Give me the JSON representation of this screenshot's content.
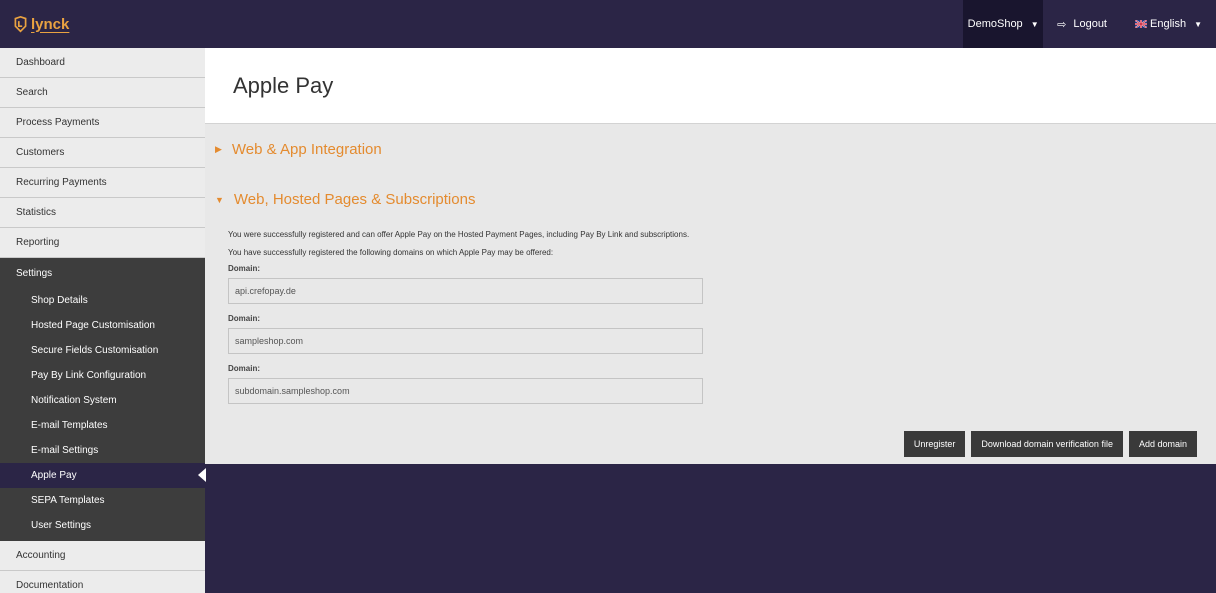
{
  "header": {
    "logo_text": "lynck",
    "shop_selector": "DemoShop",
    "logout_label": "Logout",
    "language_label": "English"
  },
  "sidebar": {
    "items": [
      {
        "label": "Dashboard"
      },
      {
        "label": "Search"
      },
      {
        "label": "Process Payments"
      },
      {
        "label": "Customers"
      },
      {
        "label": "Recurring Payments"
      },
      {
        "label": "Statistics"
      },
      {
        "label": "Reporting"
      },
      {
        "label": "Settings"
      }
    ],
    "settings_sub": [
      {
        "label": "Shop Details"
      },
      {
        "label": "Hosted Page Customisation"
      },
      {
        "label": "Secure Fields Customisation"
      },
      {
        "label": "Pay By Link Configuration"
      },
      {
        "label": "Notification System"
      },
      {
        "label": "E-mail Templates"
      },
      {
        "label": "E-mail Settings"
      },
      {
        "label": "Apple Pay"
      },
      {
        "label": "SEPA Templates"
      },
      {
        "label": "User Settings"
      }
    ],
    "bottom_items": [
      {
        "label": "Accounting"
      },
      {
        "label": "Documentation"
      }
    ]
  },
  "main": {
    "page_title": "Apple Pay",
    "section_web_app": "Web & App Integration",
    "section_hosted": "Web, Hosted Pages & Subscriptions",
    "msg_registered": "You were successfully registered and can offer Apple Pay on the Hosted Payment Pages, including Pay By Link and subscriptions.",
    "msg_domains": "You have successfully registered the following domains on which Apple Pay may be offered:",
    "domain_label": "Domain:",
    "domains": [
      "api.crefopay.de",
      "sampleshop.com",
      "subdomain.sampleshop.com"
    ],
    "buttons": {
      "unregister": "Unregister",
      "download": "Download domain verification file",
      "add_domain": "Add domain"
    }
  },
  "colors": {
    "navbar": "#2b2546",
    "accent": "#e48b2f",
    "sidebar_dark": "#3d3d3d"
  }
}
